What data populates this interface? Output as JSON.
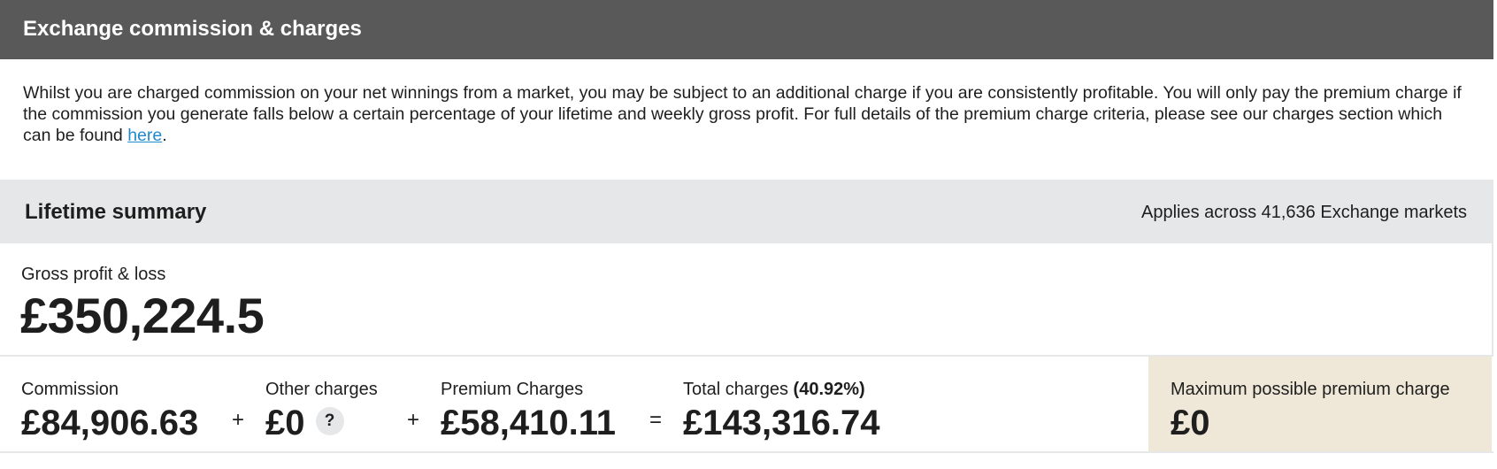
{
  "header": {
    "title": "Exchange commission & charges"
  },
  "intro": {
    "text_before_link": "Whilst you are charged commission on your net winnings from a market, you may be subject to an additional charge if you are consistently profitable. You will only pay the premium charge if the commission you generate falls below a certain percentage of your lifetime and weekly gross profit. For full details of the premium charge criteria, please see our charges section which can be found ",
    "link_label": "here",
    "text_after_link": "."
  },
  "summary": {
    "title": "Lifetime summary",
    "note": "Applies across 41,636 Exchange markets"
  },
  "gross": {
    "label": "Gross profit & loss",
    "value": "£350,224.5"
  },
  "charges": {
    "commission": {
      "label": "Commission",
      "value": "£84,906.63"
    },
    "other": {
      "label": "Other charges",
      "value": "£0",
      "help_icon": "?"
    },
    "premium": {
      "label": "Premium Charges",
      "value": "£58,410.11"
    },
    "total": {
      "label": "Total charges",
      "percentage": "(40.92%)",
      "value": "£143,316.74"
    },
    "operators": {
      "plus_1": "+",
      "plus_2": "+",
      "equals": "="
    }
  },
  "max_premium": {
    "label": "Maximum possible premium charge",
    "value": "£0"
  },
  "colors": {
    "header_bg": "#595959",
    "summary_bg": "#e6e7e8",
    "max_box_bg": "#efe8d8",
    "link": "#1f8ad0"
  }
}
